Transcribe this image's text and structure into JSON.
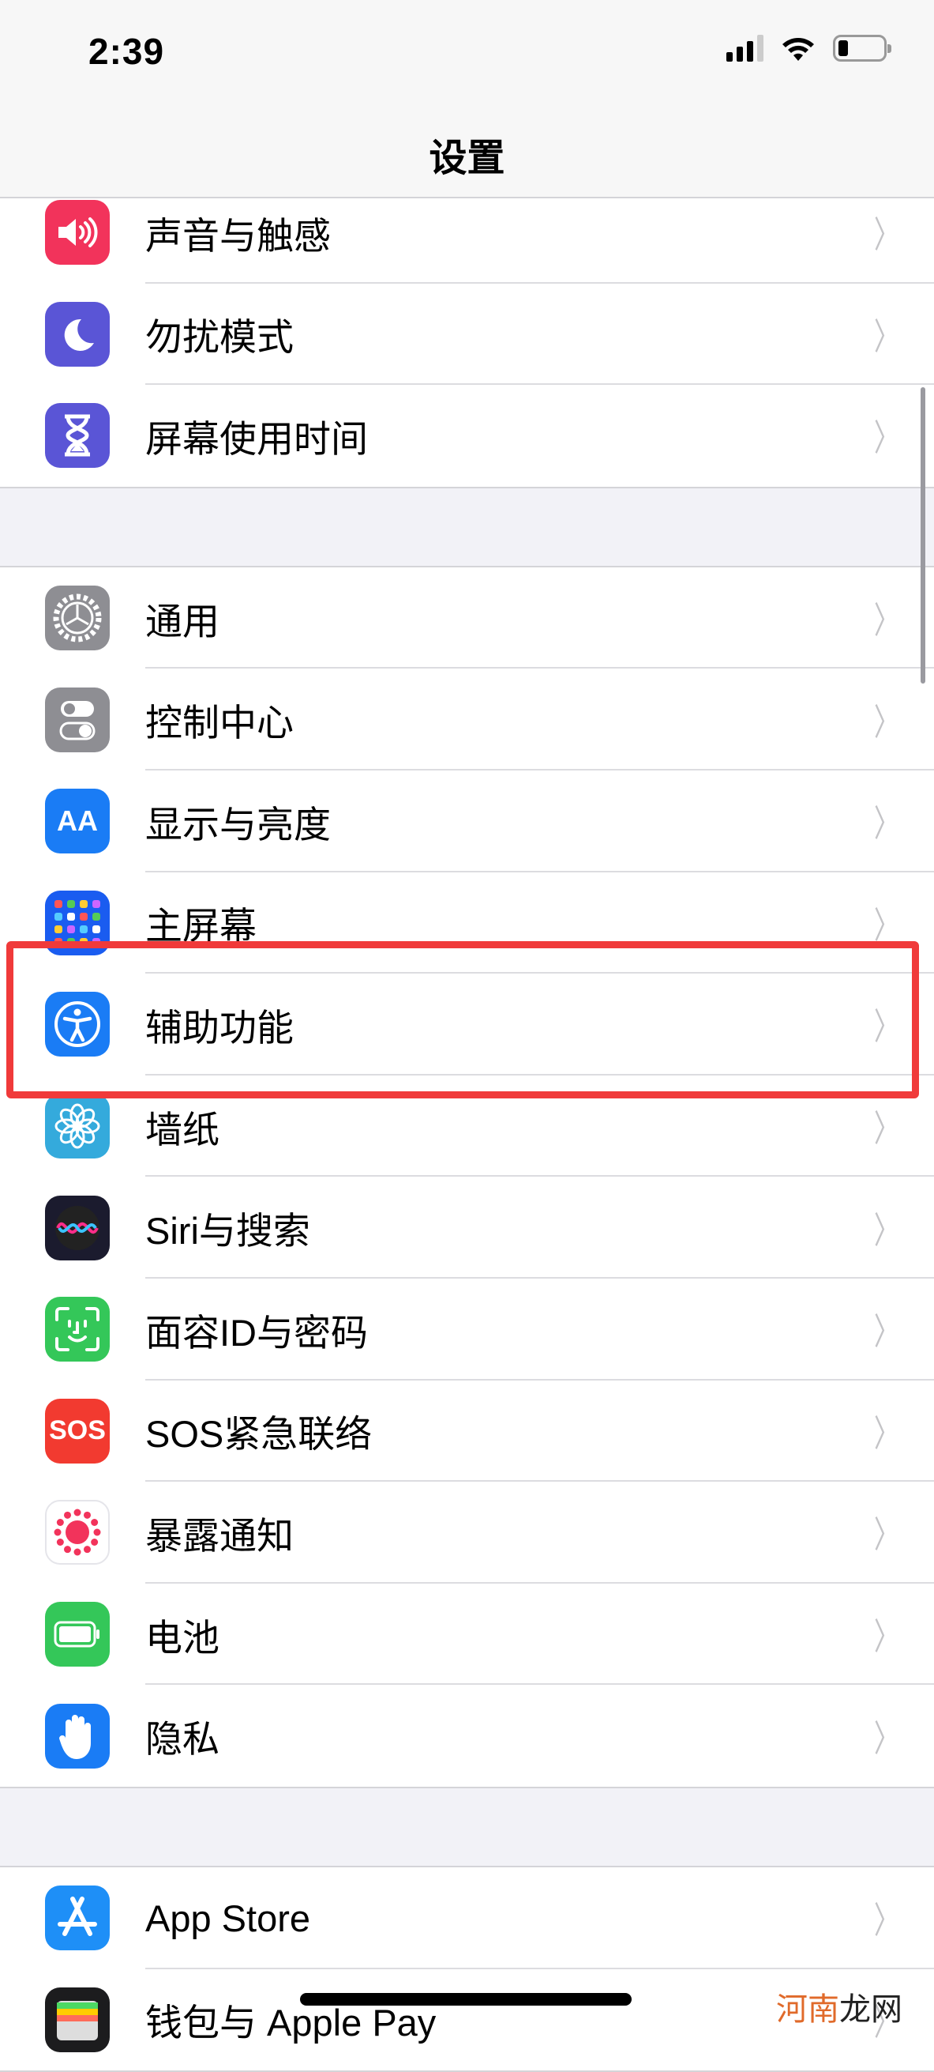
{
  "status_bar": {
    "time": "2:39",
    "signal_bars": 3,
    "battery_level": 0.15
  },
  "header": {
    "title": "设置"
  },
  "groups": [
    [
      {
        "label": "声音与触感",
        "icon": "speaker-icon",
        "color": "#f2335b"
      },
      {
        "label": "勿扰模式",
        "icon": "moon-icon",
        "color": "#5a55d6"
      },
      {
        "label": "屏幕使用时间",
        "icon": "hourglass-icon",
        "color": "#5a55d6"
      }
    ],
    [
      {
        "label": "通用",
        "icon": "gear-icon",
        "color": "#8e8e93"
      },
      {
        "label": "控制中心",
        "icon": "toggles-icon",
        "color": "#8e8e93"
      },
      {
        "label": "显示与亮度",
        "icon": "text-size-icon",
        "color": "#1a7cf5",
        "glyph": "AA"
      },
      {
        "label": "主屏幕",
        "icon": "home-screen-icon",
        "color": "#1a5cf0"
      },
      {
        "label": "辅助功能",
        "icon": "accessibility-icon",
        "color": "#1a7cf5"
      },
      {
        "label": "墙纸",
        "icon": "flower-icon",
        "color": "#34aadc"
      },
      {
        "label": "Siri与搜索",
        "icon": "siri-icon",
        "color": "#1b1b2e"
      },
      {
        "label": "面容ID与密码",
        "icon": "face-id-icon",
        "color": "#34c759"
      },
      {
        "label": "SOS紧急联络",
        "icon": "sos-icon",
        "color": "#f23a30",
        "glyph": "SOS"
      },
      {
        "label": "暴露通知",
        "icon": "exposure-icon",
        "color": "#ffffff"
      },
      {
        "label": "电池",
        "icon": "battery-icon",
        "color": "#34c759"
      },
      {
        "label": "隐私",
        "icon": "hand-icon",
        "color": "#1a7cf5"
      }
    ],
    [
      {
        "label": "App Store",
        "icon": "app-store-icon",
        "color": "#1e8ff7"
      },
      {
        "label": "钱包与 Apple Pay",
        "icon": "wallet-icon",
        "color": "#1c1c1e"
      }
    ]
  ],
  "highlight_color": "#f03a3a",
  "watermark": {
    "part1": "河南",
    "part2": "龙网"
  }
}
